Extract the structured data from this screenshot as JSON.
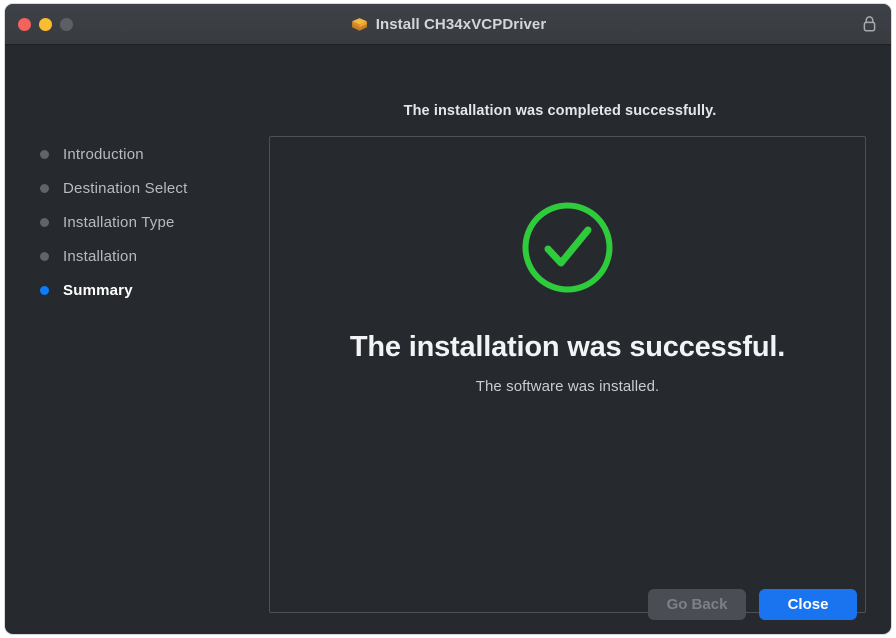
{
  "window": {
    "title": "Install CH34xVCPDriver",
    "package_icon": "package-box-icon",
    "lock_icon": "lock-closed-icon",
    "traffic_lights": [
      {
        "name": "close",
        "color": "#f3635c"
      },
      {
        "name": "minimize",
        "color": "#f9bd2f"
      },
      {
        "name": "zoom",
        "color": "#5c5f64"
      }
    ]
  },
  "sidebar": {
    "items": [
      {
        "label": "Introduction",
        "active": false
      },
      {
        "label": "Destination Select",
        "active": false
      },
      {
        "label": "Installation Type",
        "active": false
      },
      {
        "label": "Installation",
        "active": false
      },
      {
        "label": "Summary",
        "active": true
      }
    ]
  },
  "main": {
    "heading": "The installation was completed successfully.",
    "success_icon": "check-circle-icon",
    "success_title": "The installation was successful.",
    "success_subtitle": "The software was installed."
  },
  "footer": {
    "go_back_label": "Go Back",
    "close_label": "Close"
  },
  "colors": {
    "accent_blue": "#1a74f0",
    "success_green": "#2ecc3c",
    "window_bg": "#26292e",
    "titlebar_bg": "#3e4147"
  }
}
